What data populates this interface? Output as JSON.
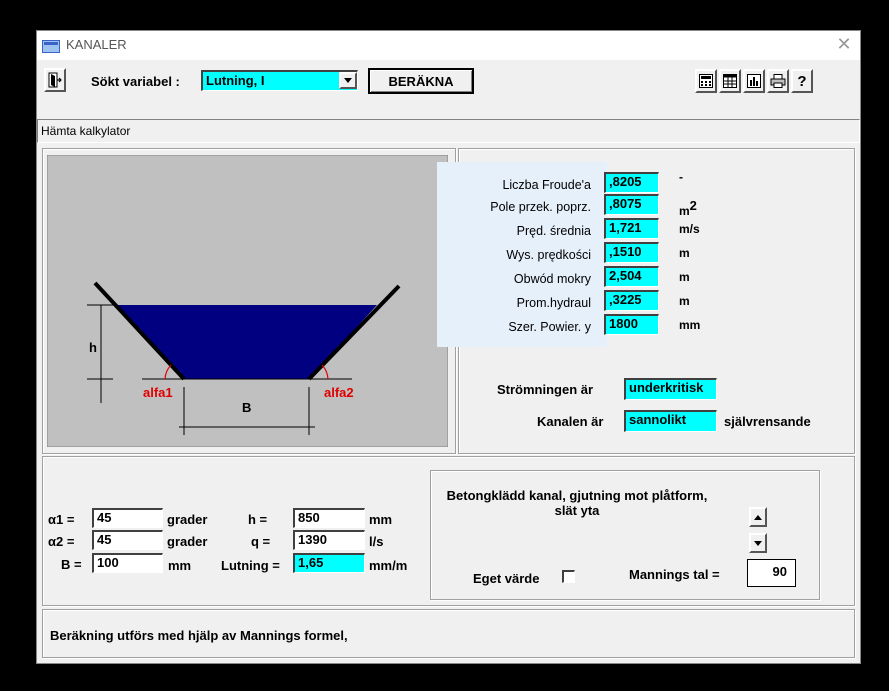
{
  "window": {
    "title": "KANALER",
    "close": "✕"
  },
  "toolbar": {
    "sokt_label": "Sökt variabel :",
    "sokt_value": "Lutning, I",
    "calc_button": "BERÄKNA",
    "help": "?"
  },
  "menu": {
    "hamta": "Hämta kalkylator"
  },
  "diagram": {
    "h_label": "h",
    "b_label": "B",
    "alfa1": "alfa1",
    "alfa2": "alfa2",
    "colors": {
      "water": "#000080",
      "angle": "#e00000",
      "bg": "#c0c0c0"
    }
  },
  "results": [
    {
      "label": "Liczba Froude'a",
      "value": ",8205",
      "unit": "-"
    },
    {
      "label": "Pole przek. poprz.",
      "value": ",8075",
      "unit": "m",
      "sup": "2"
    },
    {
      "label": "Pręd. średnia",
      "value": "1,721",
      "unit": "m/s"
    },
    {
      "label": "Wys. prędkości",
      "value": ",1510",
      "unit": "m"
    },
    {
      "label": "Obwód mokry",
      "value": "2,504",
      "unit": "m"
    },
    {
      "label": "Prom.hydraul",
      "value": ",3225",
      "unit": "m"
    },
    {
      "label": "Szer.  Powier. y",
      "value": "1800",
      "unit": "mm"
    }
  ],
  "flow": {
    "stromningen_label": "Strömningen är",
    "stromningen_value": "underkritisk",
    "kanalen_label": "Kanalen är",
    "kanalen_value": "sannolikt",
    "kanalen_suffix": "självrensande"
  },
  "inputs": {
    "a1_label": "α1 =",
    "a1_value": "45",
    "a1_unit": "grader",
    "a2_label": "α2 =",
    "a2_value": "45",
    "a2_unit": "grader",
    "b_label": "B =",
    "b_value": "100",
    "b_unit": "mm",
    "h_label": "h =",
    "h_value": "850",
    "h_unit": "mm",
    "q_label": "q =",
    "q_value": "1390",
    "q_unit": "l/s",
    "lut_label": "Lutning =",
    "lut_value": "1,65",
    "lut_unit": "mm/m"
  },
  "material": {
    "description": "Betongklädd kanal, gjutning mot plåtform, slät yta",
    "eget_label": "Eget värde",
    "mannings_label": "Mannings tal =",
    "mannings_value": "90"
  },
  "status": {
    "text": "Beräkning utförs med hjälp av Mannings formel,"
  }
}
